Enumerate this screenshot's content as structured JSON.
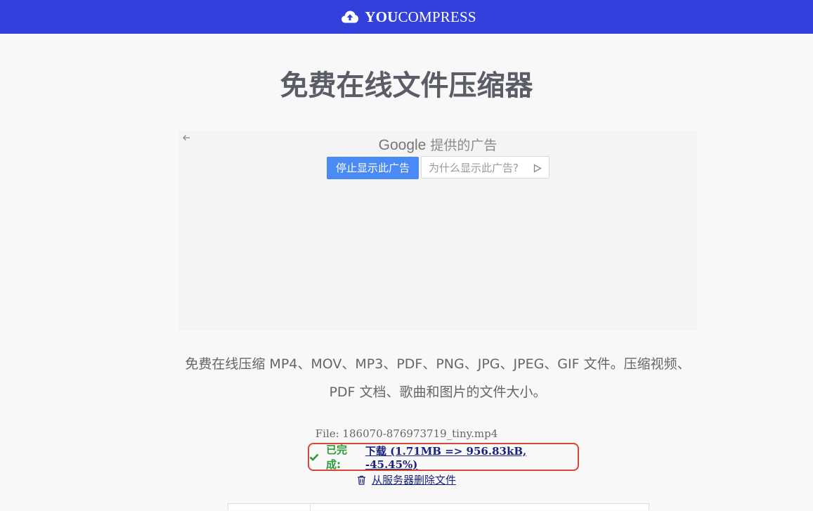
{
  "header": {
    "brand_bold": "YOU",
    "brand_light": "COMPRESS",
    "brand_icon": "cloud-upload-icon",
    "background_color": "#3340dc"
  },
  "main": {
    "title": "免费在线文件压缩器",
    "description": "免费在线压缩 MP4、MOV、MP3、PDF、PNG、JPG、JPEG、GIF 文件。压缩视频、PDF 文档、歌曲和图片的文件大小。"
  },
  "ad": {
    "back_icon": "arrow-left-icon",
    "google_label": "Google",
    "provider_suffix": "提供的广告",
    "stop_button_label": "停止显示此广告",
    "why_button_label": "为什么显示此广告?",
    "why_icon": "play-outline-icon",
    "stop_button_color": "#4a8af4"
  },
  "result": {
    "file_line": "File: 186070-876973719_tiny.mp4",
    "status_icon": "check-icon",
    "status_label": "已完成:",
    "download_label": "下载 (1.71MB => 956.83kB, -45.45%)",
    "delete_icon": "trash-icon",
    "delete_label": "从服务器删除文件",
    "highlight_color": "#d84638",
    "success_color": "#2e9b3b"
  }
}
